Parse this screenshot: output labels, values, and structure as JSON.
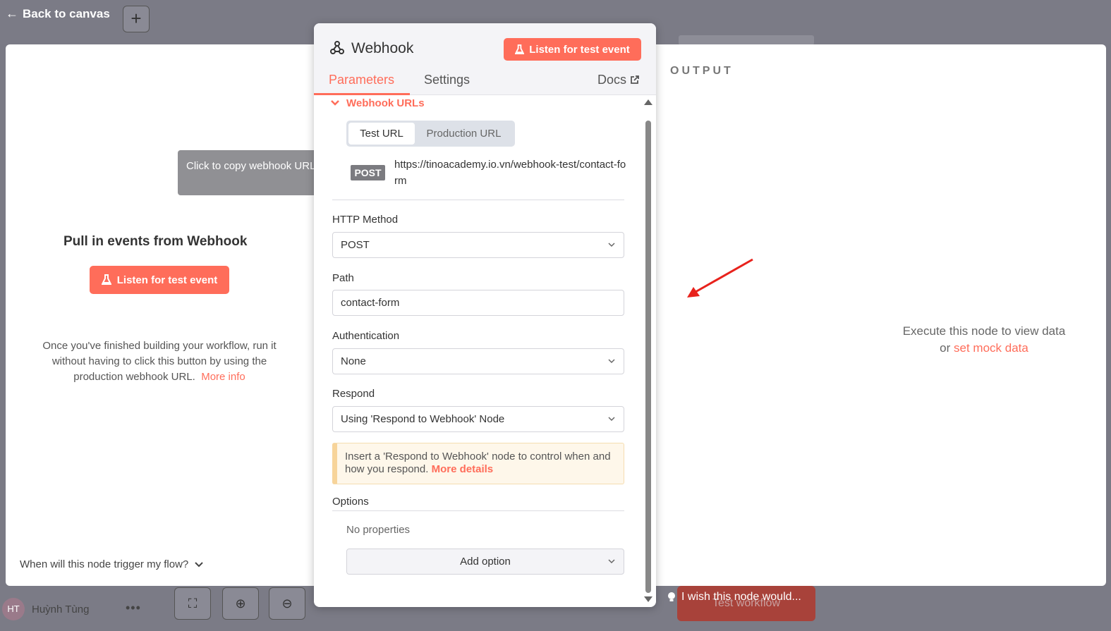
{
  "topbar": {
    "back_label": "Back to canvas",
    "add_glyph": "+"
  },
  "bottombar": {
    "avatar_initials": "HT",
    "user_name": "Huỳnh Tùng",
    "more_glyph": "•••",
    "test_workflow_label": "Test workflow"
  },
  "input_panel": {
    "title": "Pull in events from Webhook",
    "listen_label": "Listen for test event",
    "description": "Once you've finished building your workflow, run it without having to click this button by using the production webhook URL.",
    "more_info_link": "More info",
    "trigger_question": "When will this node trigger my flow?"
  },
  "tooltip": {
    "text": "Click to copy webhook URLs"
  },
  "node": {
    "title": "Webhook",
    "listen_label": "Listen for test event",
    "tabs": {
      "parameters": "Parameters",
      "settings": "Settings",
      "docs": "Docs"
    },
    "webhook_urls": {
      "section_title": "Webhook URLs",
      "test_url_tab": "Test URL",
      "production_url_tab": "Production URL",
      "method_badge": "POST",
      "url": "https://tinoacademy.io.vn/webhook-test/contact-form"
    },
    "http_method": {
      "label": "HTTP Method",
      "value": "POST"
    },
    "path": {
      "label": "Path",
      "value": "contact-form"
    },
    "authentication": {
      "label": "Authentication",
      "value": "None"
    },
    "respond": {
      "label": "Respond",
      "value": "Using 'Respond to Webhook' Node"
    },
    "notice": {
      "text": "Insert a 'Respond to Webhook' node to control when and how you respond.",
      "link": "More details"
    },
    "options": {
      "label": "Options",
      "empty_text": "No properties",
      "add_label": "Add option"
    }
  },
  "output_panel": {
    "label": "OUTPUT",
    "empty_line1": "Execute this node to view data",
    "empty_or": "or",
    "mock_link": "set mock data",
    "feedback_label": "I wish this node would..."
  },
  "colors": {
    "accent": "#ff6d5a",
    "backdrop": "#7a7a85",
    "annotation_arrow": "#e8221c"
  }
}
